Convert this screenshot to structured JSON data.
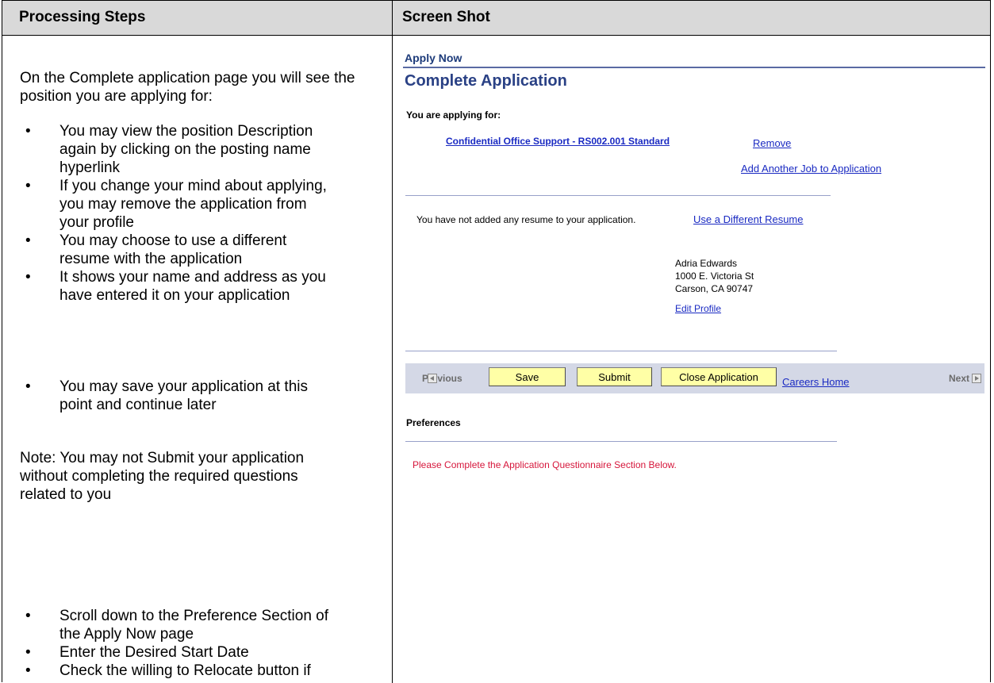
{
  "table": {
    "header_left": "Processing Steps",
    "header_right": "Screen Shot"
  },
  "left": {
    "intro": "On the Complete application page you will see the position you are applying for:",
    "bullets1": [
      "You may view the position Description again by clicking on the posting name hyperlink",
      "If you change your mind about applying, you may remove the application from your profile",
      "You may choose to use a different resume with the application",
      "It shows your name and address as you have entered it on your application"
    ],
    "bullet_save": "You may save your application at this point and continue later",
    "note": "Note:  You may not Submit your application without completing the required questions related to you",
    "bullets2": [
      "Scroll down to the Preference Section of the Apply Now page",
      "Enter the Desired Start Date",
      "Check the willing to Relocate button if"
    ]
  },
  "screen": {
    "breadcrumb": "Apply Now",
    "title": "Complete Application",
    "applying_label": "You are applying for:",
    "job_link": "Confidential Office Support - RS002.001 Standard",
    "remove": "Remove",
    "add_job": "Add Another Job to Application",
    "no_resume": "You have not added any resume to your application.",
    "different_resume": "Use a Different Resume",
    "address": {
      "name": "Adria Edwards",
      "street": "1000 E. Victoria St",
      "city": "Carson, CA 90747"
    },
    "edit_profile": "Edit Profile",
    "toolbar": {
      "previous": "Previous",
      "save": "Save",
      "submit": "Submit",
      "close": "Close Application",
      "careers_home": "Careers Home",
      "next": "Next"
    },
    "preferences": "Preferences",
    "notice": "Please Complete the Application Questionnaire Section Below.",
    "colors": {
      "link": "#1a2ac2",
      "title": "#2a4185",
      "notice": "#d6163b",
      "button": "#ffffa6",
      "toolbar": "#d4d8e6"
    }
  }
}
